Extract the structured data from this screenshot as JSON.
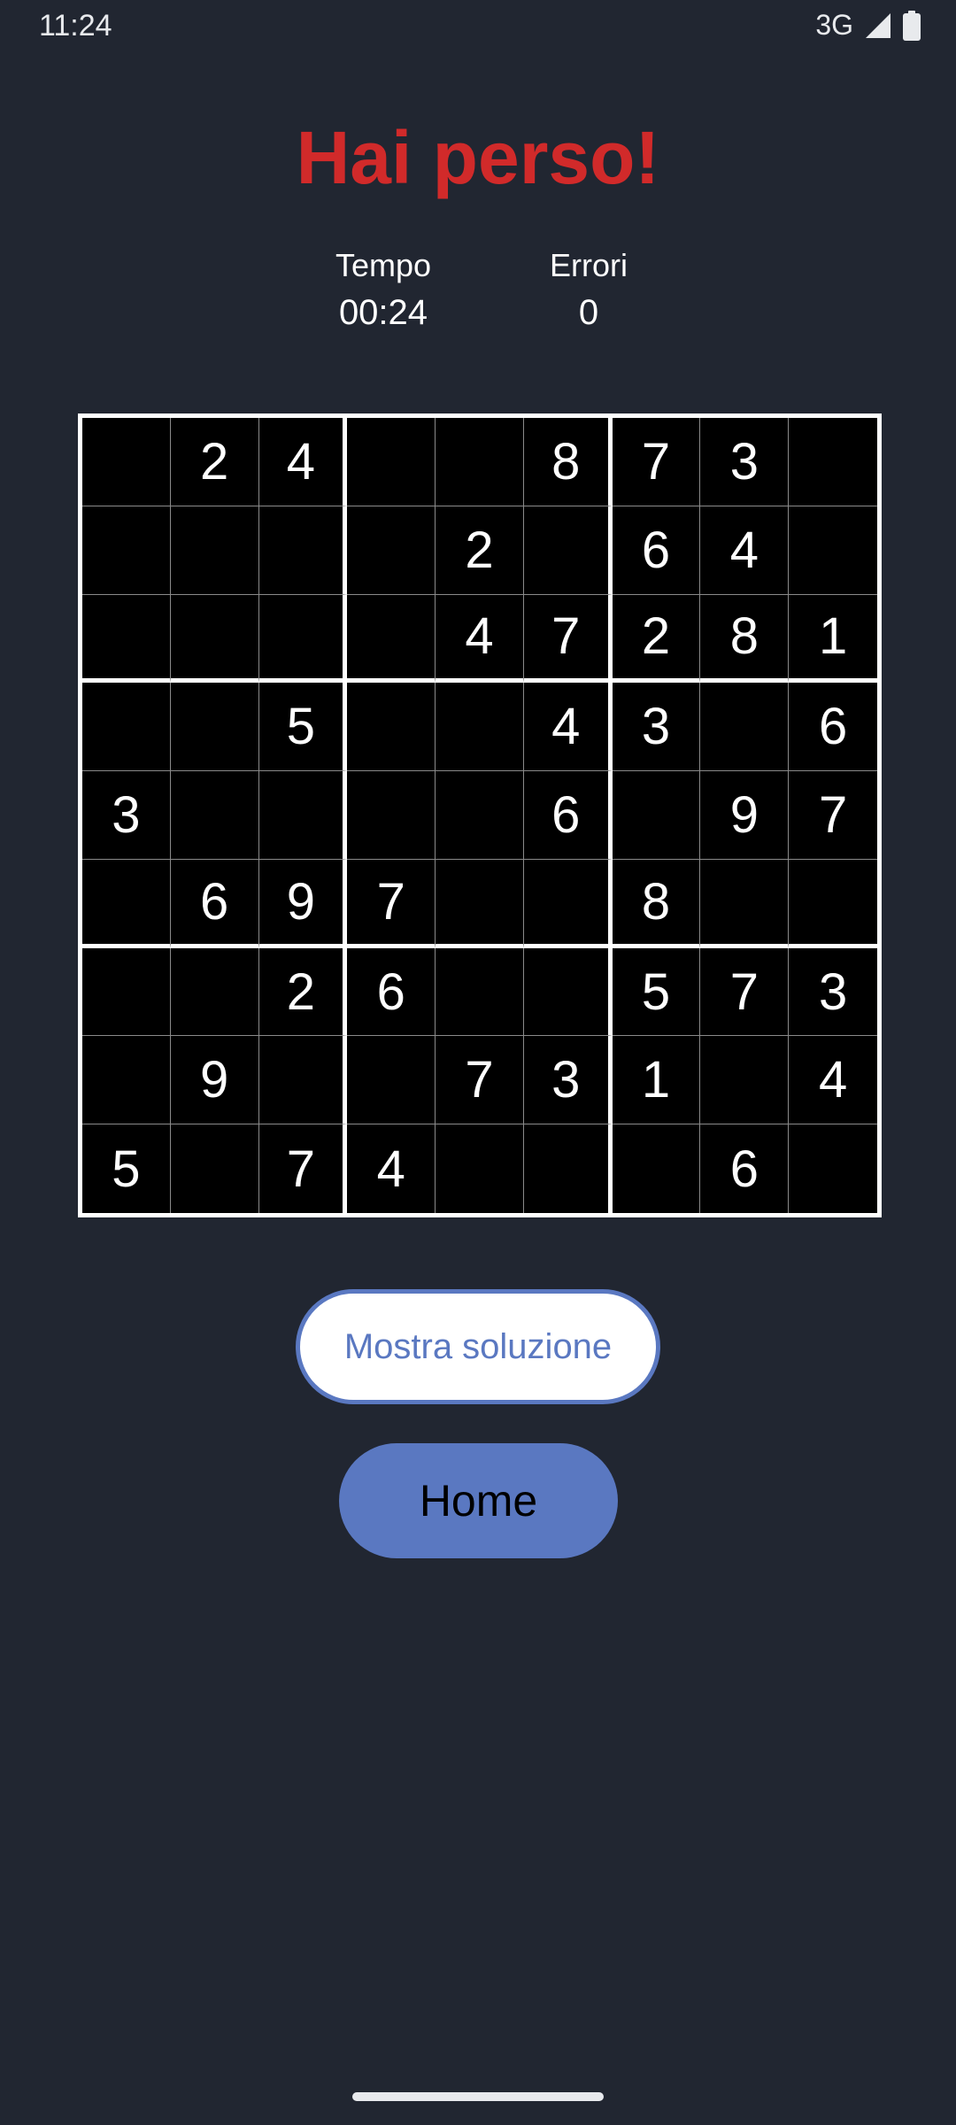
{
  "status_bar": {
    "time": "11:24",
    "network": "3G",
    "signal_icon": "signal-icon",
    "battery_icon": "battery-icon"
  },
  "game_over": {
    "title": "Hai perso!",
    "title_color": "#d12a2a",
    "time_label": "Tempo",
    "time_value": "00:24",
    "errors_label": "Errori",
    "errors_value": "0"
  },
  "board": [
    [
      "",
      "2",
      "4",
      "",
      "",
      "8",
      "7",
      "3",
      ""
    ],
    [
      "",
      "",
      "",
      "",
      "2",
      "",
      "6",
      "4",
      ""
    ],
    [
      "",
      "",
      "",
      "",
      "4",
      "7",
      "2",
      "8",
      "1"
    ],
    [
      "",
      "",
      "5",
      "",
      "",
      "4",
      "3",
      "",
      "6"
    ],
    [
      "3",
      "",
      "",
      "",
      "",
      "6",
      "",
      "9",
      "7"
    ],
    [
      "",
      "6",
      "9",
      "7",
      "",
      "",
      "8",
      "",
      ""
    ],
    [
      "",
      "",
      "2",
      "6",
      "",
      "",
      "5",
      "7",
      "3"
    ],
    [
      "",
      "9",
      "",
      "",
      "7",
      "3",
      "1",
      "",
      "4"
    ],
    [
      "5",
      "",
      "7",
      "4",
      "",
      "",
      "",
      "6",
      ""
    ]
  ],
  "buttons": {
    "show_solution": "Mostra soluzione",
    "home": "Home"
  },
  "colors": {
    "background": "#212631",
    "accent": "#5a78c1",
    "grid_background": "#000000"
  }
}
